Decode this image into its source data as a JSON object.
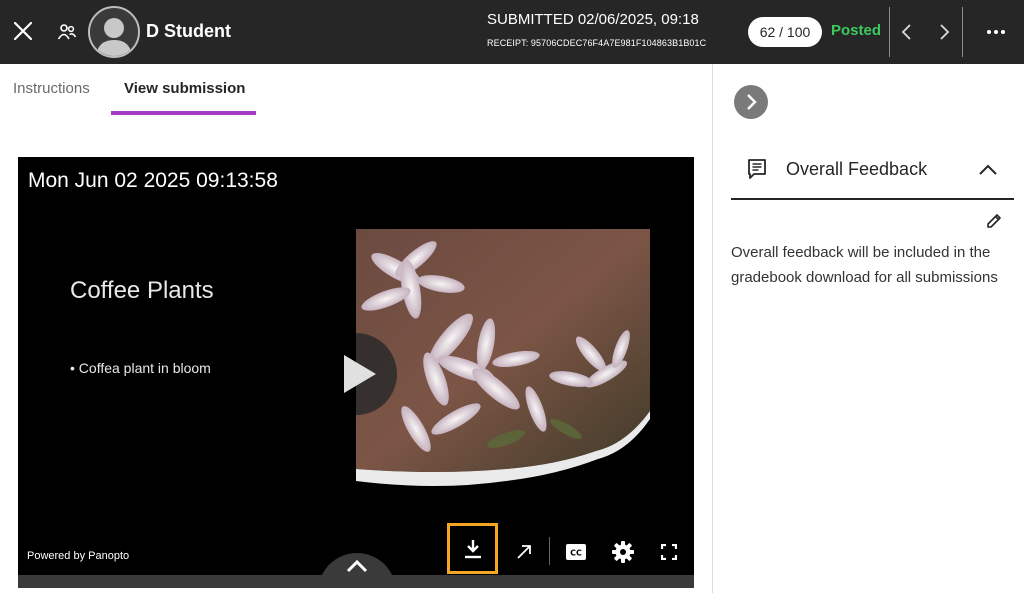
{
  "header": {
    "student_name": "D Student",
    "submitted": "SUBMITTED 02/06/2025, 09:18",
    "receipt": "RECEIPT: 95706CDEC76F4A7E981F104863B1B01C",
    "score": "62 / 100",
    "status": "Posted",
    "status_color": "#3ec95e",
    "icons": [
      "close-icon",
      "people-icon",
      "avatar",
      "chevron-left-icon",
      "chevron-right-icon",
      "more-icon"
    ]
  },
  "tabs": [
    {
      "label": "Instructions",
      "active": false
    },
    {
      "label": "View submission",
      "active": true
    }
  ],
  "accent_color": "#a33bc3",
  "video": {
    "timestamp": "Mon Jun 02 2025 09:13:58",
    "slide_title": "Coffee Plants",
    "slide_bullet": "• Coffea plant in bloom",
    "powered_by": "Powered by Panopto",
    "highlight_color": "#f5a623",
    "controls": [
      "download-icon",
      "open-external-icon",
      "captions-icon",
      "settings-icon",
      "fullscreen-icon"
    ]
  },
  "feedback": {
    "title": "Overall Feedback",
    "text": "Overall feedback will be included in the gradebook download for all submissions"
  }
}
